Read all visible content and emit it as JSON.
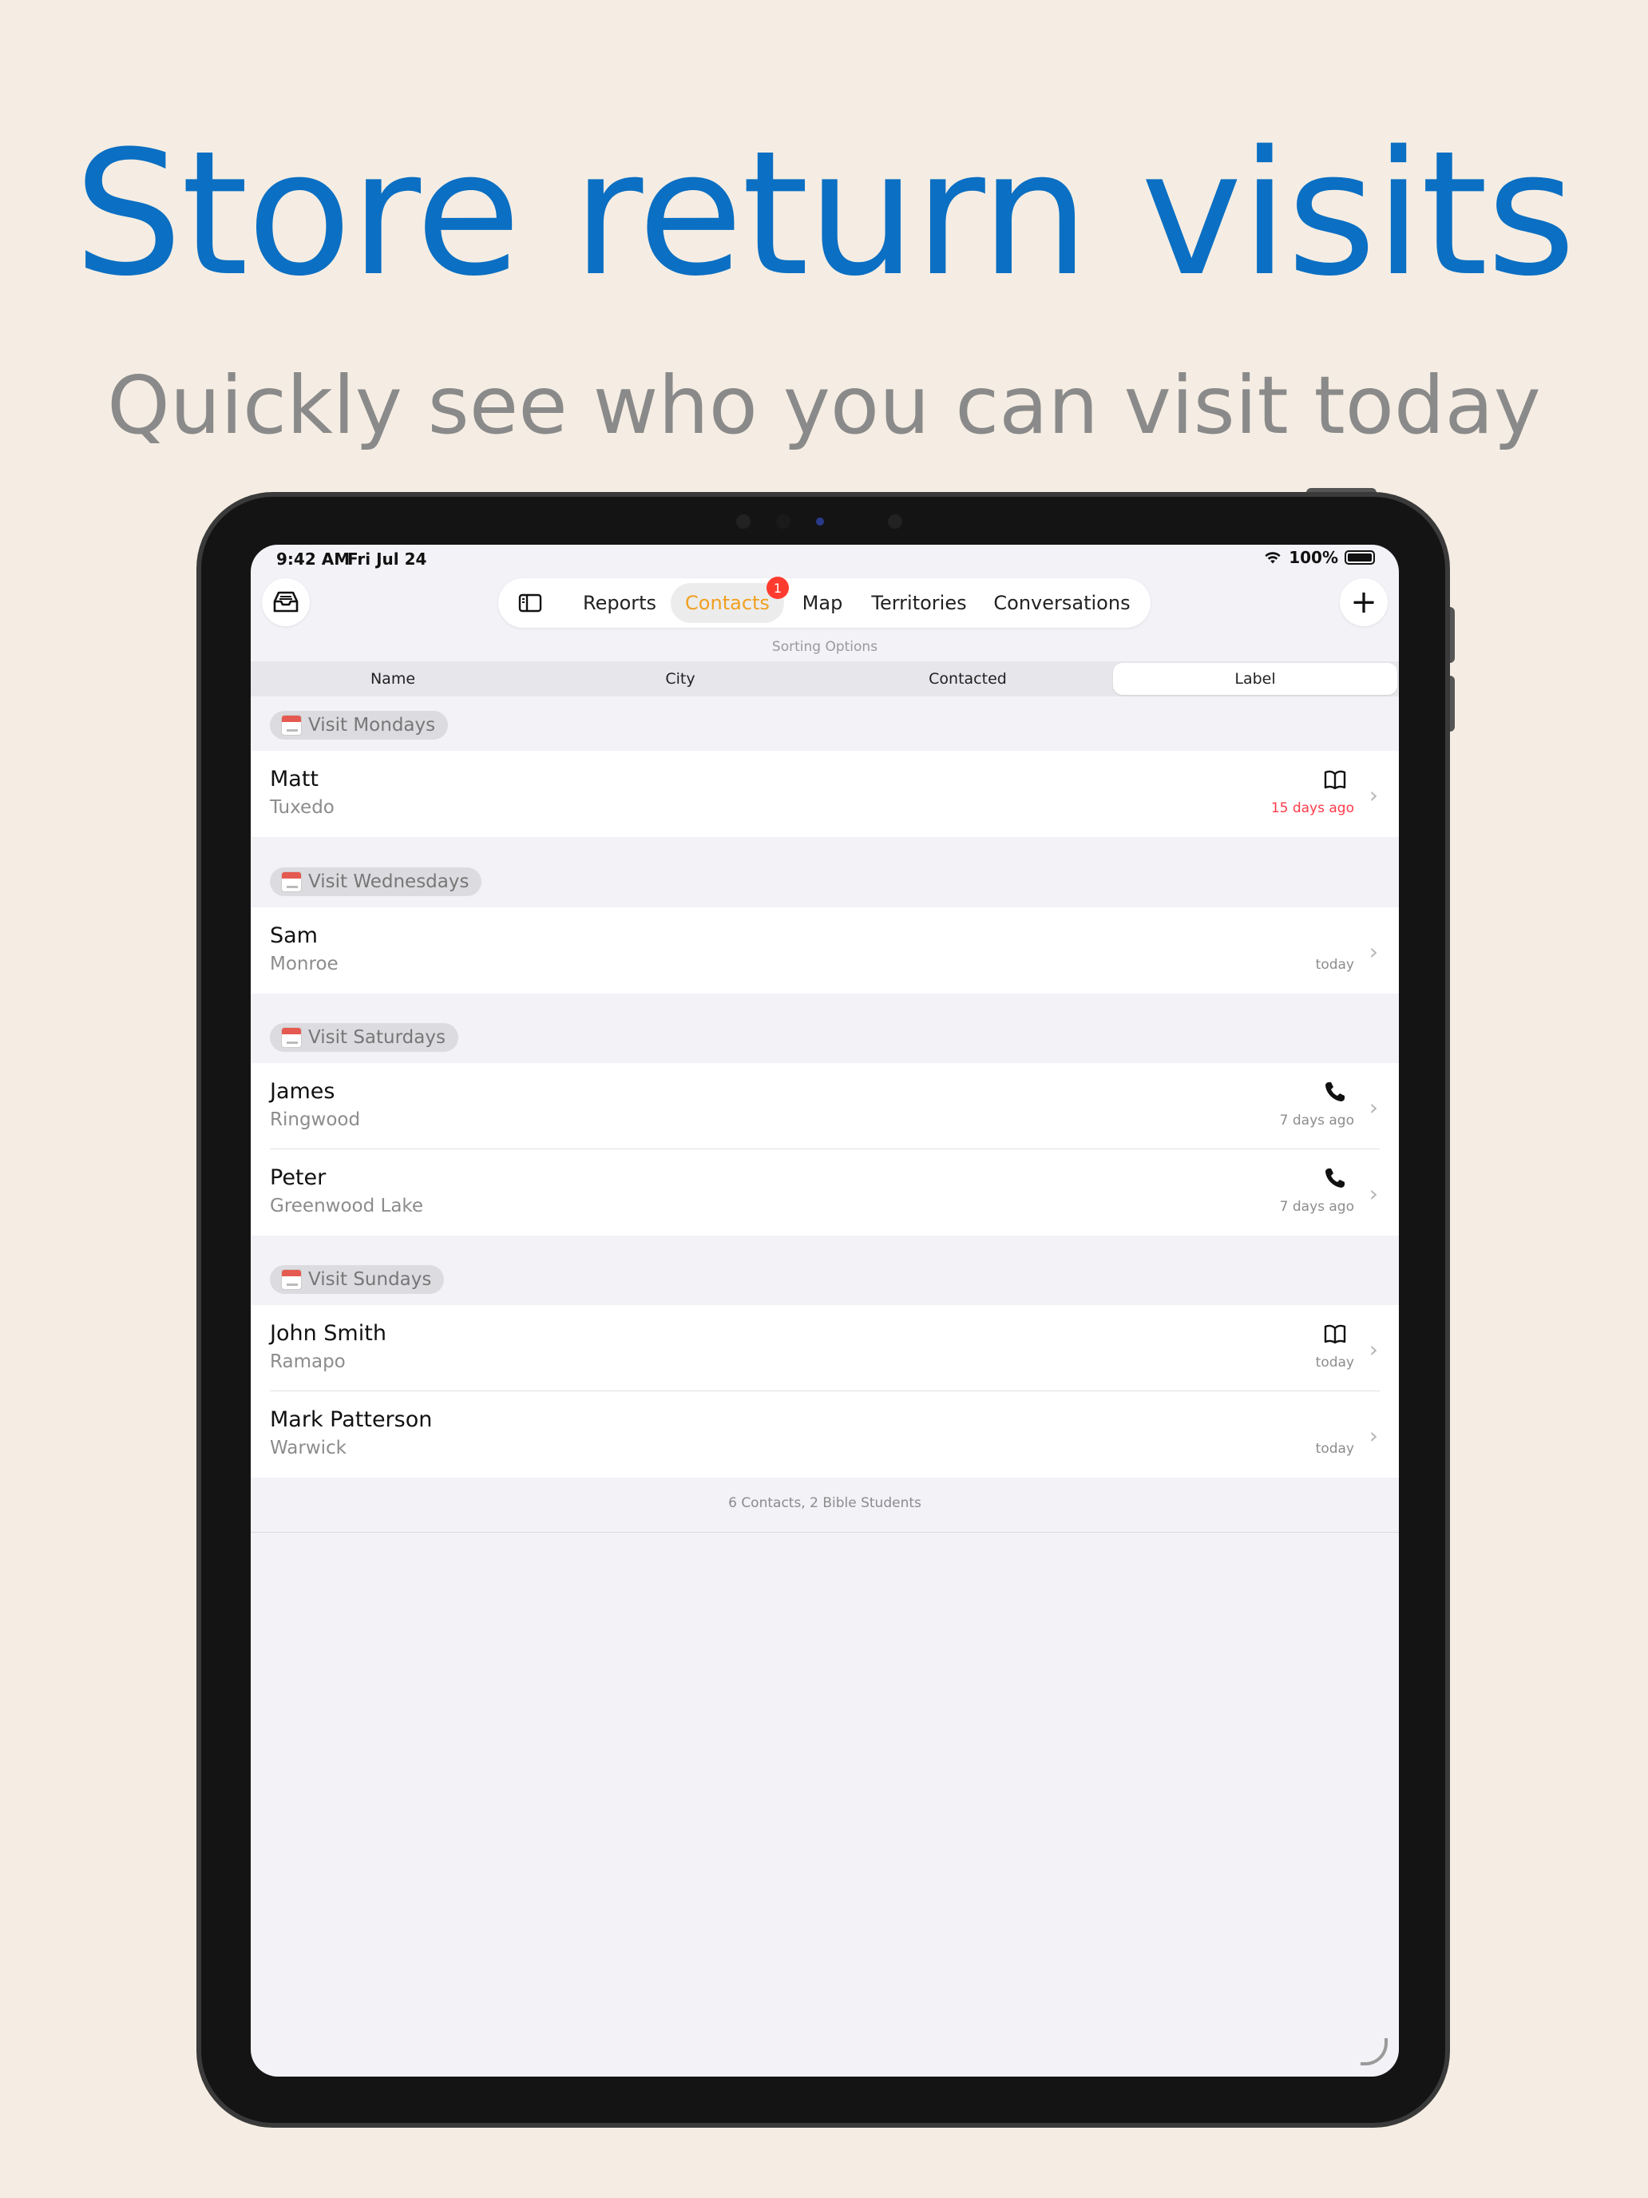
{
  "hero": {
    "title": "Store return visits",
    "subtitle": "Quickly see who you can visit today"
  },
  "status_bar": {
    "time": "9:42 AM",
    "date": "Fri Jul 24",
    "battery": "100%"
  },
  "toolbar": {
    "inbox_icon": "inbox-tray-icon",
    "sidebar_icon": "sidebar-toggle-icon",
    "tabs": [
      {
        "label": "Reports"
      },
      {
        "label": "Contacts",
        "badge": "1"
      },
      {
        "label": "Map"
      },
      {
        "label": "Territories"
      },
      {
        "label": "Conversations"
      }
    ],
    "active_tab": "Contacts",
    "add_icon": "plus-icon",
    "accent": "#f0a020",
    "badge_color": "#ff3b30"
  },
  "sorting": {
    "caption": "Sorting Options",
    "options": [
      "Name",
      "City",
      "Contacted",
      "Label"
    ],
    "selected": "Label"
  },
  "groups": [
    {
      "label": "Visit Mondays",
      "contacts": [
        {
          "name": "Matt",
          "city": "Tuxedo",
          "icon": "book-icon",
          "last_contact": "15 days ago",
          "overdue": true
        }
      ]
    },
    {
      "label": "Visit Wednesdays",
      "contacts": [
        {
          "name": "Sam",
          "city": "Monroe",
          "icon": "",
          "last_contact": "today",
          "overdue": false
        }
      ]
    },
    {
      "label": "Visit Saturdays",
      "contacts": [
        {
          "name": "James",
          "city": "Ringwood",
          "icon": "phone-icon",
          "last_contact": "7 days ago",
          "overdue": false
        },
        {
          "name": "Peter",
          "city": "Greenwood Lake",
          "icon": "phone-icon",
          "last_contact": "7 days ago",
          "overdue": false
        }
      ]
    },
    {
      "label": "Visit Sundays",
      "contacts": [
        {
          "name": "John Smith",
          "city": "Ramapo",
          "icon": "book-icon",
          "last_contact": "today",
          "overdue": false
        },
        {
          "name": "Mark Patterson",
          "city": "Warwick",
          "icon": "",
          "last_contact": "today",
          "overdue": false
        }
      ]
    }
  ],
  "footer": {
    "summary": "6 Contacts, 2 Bible Students"
  },
  "colors": {
    "headline": "#0b6fc3",
    "overdue": "#ff3b4a",
    "background": "#f5ede3"
  }
}
